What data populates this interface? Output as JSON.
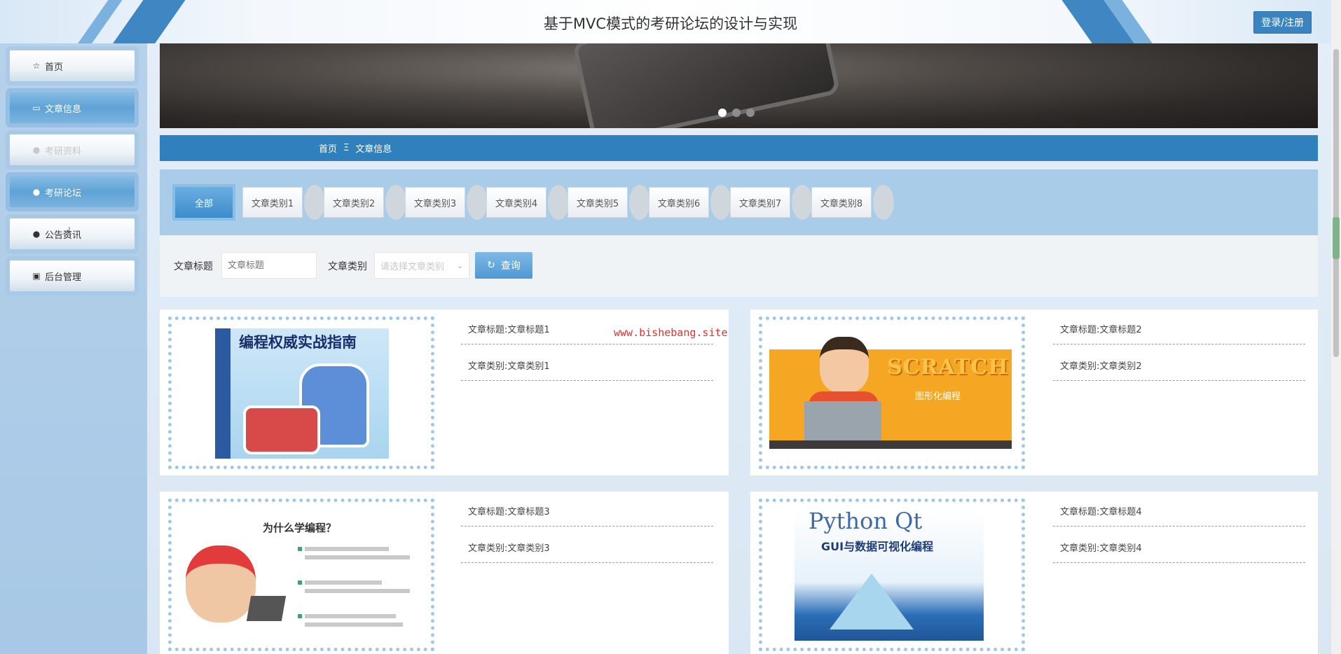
{
  "header": {
    "title": "基于MVC模式的考研论坛的设计与实现",
    "login_label": "登录/注册"
  },
  "sidebar": {
    "items": [
      {
        "label": "首页",
        "icon": "star-icon"
      },
      {
        "label": "文章信息",
        "icon": "folder-icon"
      },
      {
        "label": "考研资料",
        "icon": "shield-icon"
      },
      {
        "label": "考研论坛",
        "icon": "help-circle-icon"
      },
      {
        "label": "公告资讯",
        "icon": "info-icon"
      },
      {
        "label": "后台管理",
        "icon": "briefcase-icon"
      }
    ]
  },
  "carousel": {
    "slide_count": 3,
    "active_index": 0
  },
  "breadcrumb": {
    "home": "首页",
    "separator": "Ξ",
    "current": "文章信息"
  },
  "categories": {
    "all": "全部",
    "items": [
      "文章类别1",
      "文章类别2",
      "文章类别3",
      "文章类别4",
      "文章类别5",
      "文章类别6",
      "文章类别7",
      "文章类别8"
    ]
  },
  "search": {
    "title_label": "文章标题",
    "title_placeholder": "文章标题",
    "type_label": "文章类别",
    "type_placeholder": "请选择文章类别",
    "button_label": "查询"
  },
  "articles": [
    {
      "title": "文章标题:文章标题1",
      "category": "文章类别:文章类别1",
      "cover_text": "编程权威实战指南"
    },
    {
      "title": "文章标题:文章标题2",
      "category": "文章类别:文章类别2",
      "cover_text": "SCRATCH",
      "cover_sub": "图形化编程"
    },
    {
      "title": "文章标题:文章标题3",
      "category": "文章类别:文章类别3",
      "cover_text": "为什么学编程？"
    },
    {
      "title": "文章标题:文章标题4",
      "category": "文章类别:文章类别4",
      "cover_text": "Python Qt",
      "cover_sub": "GUI与数据可视化编程"
    }
  ],
  "watermark": "www.bishebang.site",
  "colors": {
    "brand": "#2f80bd",
    "accent_light": "#a9cce9",
    "watermark": "#e03131"
  }
}
